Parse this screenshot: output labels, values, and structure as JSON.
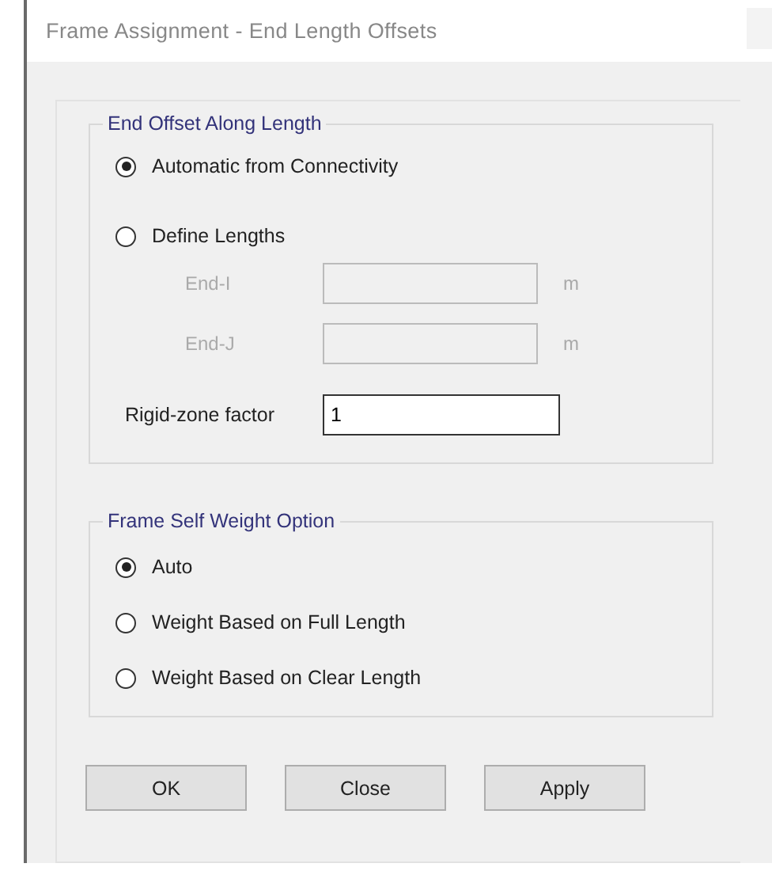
{
  "window": {
    "title": "Frame Assignment - End Length Offsets"
  },
  "end_offset": {
    "title": "End Offset Along Length",
    "options": [
      {
        "label": "Automatic from Connectivity",
        "selected": true
      },
      {
        "label": "Define Lengths",
        "selected": false
      }
    ],
    "lengths": [
      {
        "label": "End-I",
        "unit": "m",
        "disabled": true
      },
      {
        "label": "End-J",
        "unit": "m",
        "disabled": true
      }
    ],
    "rigid_zone": {
      "label": "Rigid-zone factor",
      "value": "1"
    }
  },
  "self_weight": {
    "title": "Frame Self Weight Option",
    "options": [
      {
        "label": "Auto",
        "selected": true
      },
      {
        "label": "Weight Based on Full Length",
        "selected": false
      },
      {
        "label": "Weight Based on Clear Length",
        "selected": false
      }
    ]
  },
  "buttons": [
    "OK",
    "Close",
    "Apply"
  ]
}
